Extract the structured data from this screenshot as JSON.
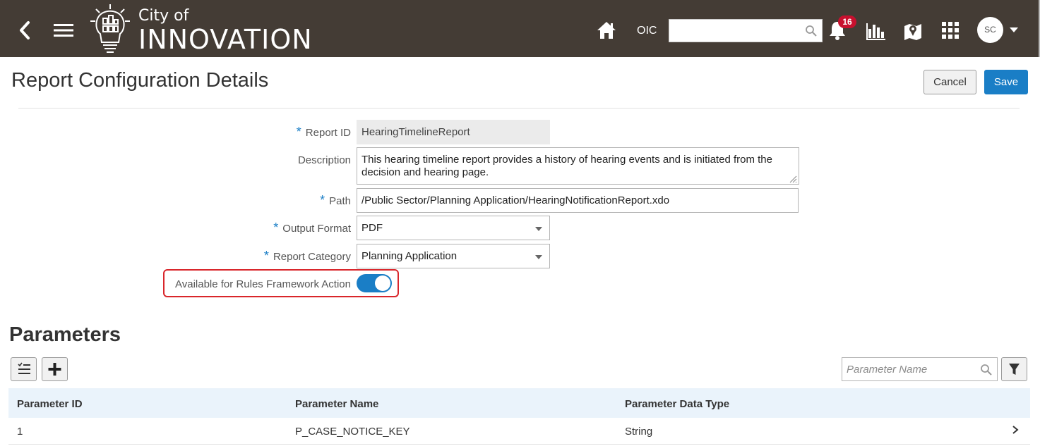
{
  "header": {
    "logo_line1": "City of",
    "logo_line2": "INNOVATION",
    "oic_label": "OIC",
    "search_value": "",
    "notification_count": "16",
    "avatar_initials": "SC",
    "bg_color": "#443c35"
  },
  "page": {
    "title": "Report Configuration Details",
    "cancel_label": "Cancel",
    "save_label": "Save"
  },
  "form": {
    "report_id": {
      "label": "Report ID",
      "required": "*",
      "value": "HearingTimelineReport"
    },
    "description": {
      "label": "Description",
      "value": "This hearing timeline report provides a history of hearing events and is initiated from the decision and hearing page."
    },
    "path": {
      "label": "Path",
      "required": "*",
      "value": "/Public Sector/Planning Application/HearingNotificationReport.xdo"
    },
    "output_format": {
      "label": "Output Format",
      "required": "*",
      "value": "PDF"
    },
    "report_category": {
      "label": "Report Category",
      "required": "*",
      "value": "Planning Application"
    },
    "rules_framework": {
      "label": "Available for Rules Framework Action",
      "enabled": true
    }
  },
  "parameters": {
    "title": "Parameters",
    "search_placeholder": "Parameter Name",
    "columns": [
      "Parameter ID",
      "Parameter Name",
      "Parameter Data Type"
    ],
    "rows": [
      {
        "id": "1",
        "name": "P_CASE_NOTICE_KEY",
        "type": "String"
      }
    ]
  },
  "colors": {
    "accent": "#1a7ec6",
    "highlight_border": "#d9262b",
    "badge": "#c8102e"
  }
}
